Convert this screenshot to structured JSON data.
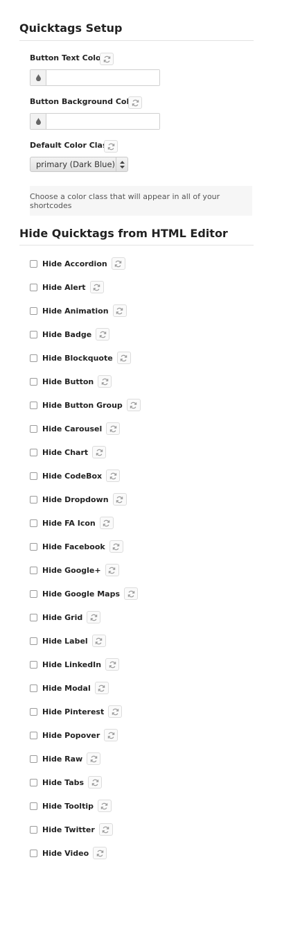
{
  "setup": {
    "title": "Quicktags Setup",
    "button_text_color_label": "Button Text Color",
    "button_text_color_value": "",
    "button_bg_color_label": "Button Background Color",
    "button_bg_color_value": "",
    "default_color_class_label": "Default Color Class",
    "default_color_class_value": "primary (Dark Blue)",
    "help_text": "Choose a color class that will appear in all of your shortcodes"
  },
  "hide": {
    "title": "Hide Quicktags from HTML Editor",
    "items": [
      {
        "label": "Hide Accordion"
      },
      {
        "label": "Hide Alert"
      },
      {
        "label": "Hide Animation"
      },
      {
        "label": "Hide Badge"
      },
      {
        "label": "Hide Blockquote"
      },
      {
        "label": "Hide Button"
      },
      {
        "label": "Hide Button Group"
      },
      {
        "label": "Hide Carousel"
      },
      {
        "label": "Hide Chart"
      },
      {
        "label": "Hide CodeBox"
      },
      {
        "label": "Hide Dropdown"
      },
      {
        "label": "Hide FA Icon"
      },
      {
        "label": "Hide Facebook"
      },
      {
        "label": "Hide Google+"
      },
      {
        "label": "Hide Google Maps"
      },
      {
        "label": "Hide Grid"
      },
      {
        "label": "Hide Label"
      },
      {
        "label": "Hide LinkedIn"
      },
      {
        "label": "Hide Modal"
      },
      {
        "label": "Hide Pinterest"
      },
      {
        "label": "Hide Popover"
      },
      {
        "label": "Hide Raw"
      },
      {
        "label": "Hide Tabs"
      },
      {
        "label": "Hide Tooltip"
      },
      {
        "label": "Hide Twitter"
      },
      {
        "label": "Hide Video"
      }
    ]
  },
  "icons": {
    "reset": "refresh-icon",
    "color": "droplet-icon",
    "select_arrows": "up-down-arrows-icon"
  },
  "colors": {
    "rule": "#e2e2e2",
    "help_bg": "#f6f6f6"
  }
}
